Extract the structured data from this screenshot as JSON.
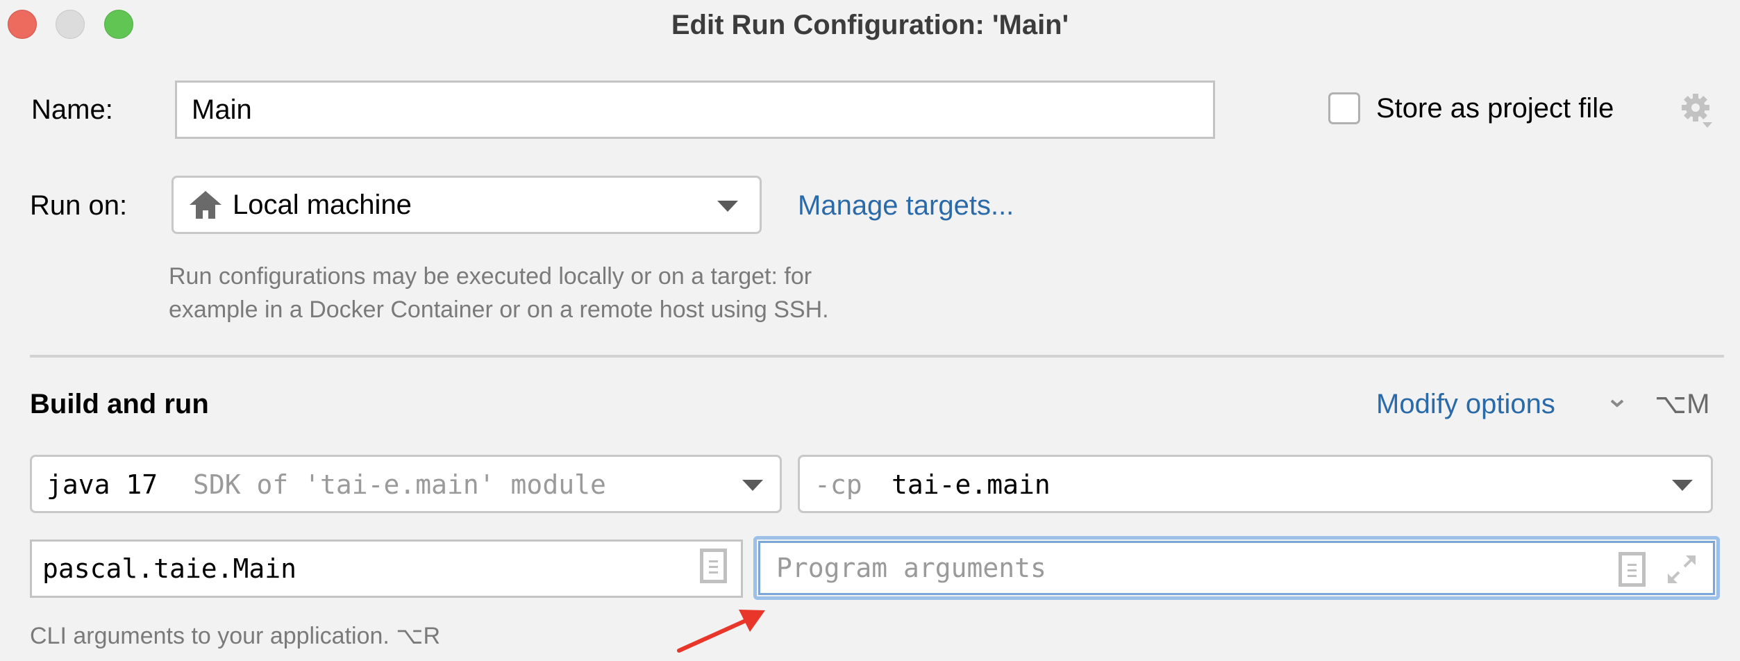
{
  "window": {
    "title": "Edit Run Configuration: 'Main'",
    "controls": [
      "close",
      "minimize",
      "maximize"
    ]
  },
  "name_row": {
    "label": "Name:",
    "value": "Main",
    "store_checkbox_label": "Store as project file",
    "store_checked": false,
    "settings_icon": "gear-icon"
  },
  "run_on": {
    "label": "Run on:",
    "selected": "Local machine",
    "selected_icon": "home-icon",
    "manage_link": "Manage targets...",
    "help_line1": "Run configurations may be executed locally or on a target: for",
    "help_line2": "example in a Docker Container or on a remote host using SSH."
  },
  "build_and_run": {
    "heading": "Build and run",
    "modify_options": "Modify options",
    "modify_shortcut": "⌥M",
    "sdk": {
      "primary": "java 17",
      "secondary": "SDK of 'tai-e.main' module"
    },
    "classpath": {
      "prefix": "-cp",
      "value": "tai-e.main"
    },
    "main_class": "pascal.taie.Main",
    "program_arguments": {
      "value": "",
      "placeholder": "Program arguments"
    },
    "hint": "CLI arguments to your application. ⌥R"
  },
  "annotation": {
    "arrow_color": "#e8372a",
    "points_to": "program-arguments-input"
  },
  "colors": {
    "link": "#2a6aa8",
    "focus": "#9cc0e8",
    "background": "#f2f2f2"
  }
}
